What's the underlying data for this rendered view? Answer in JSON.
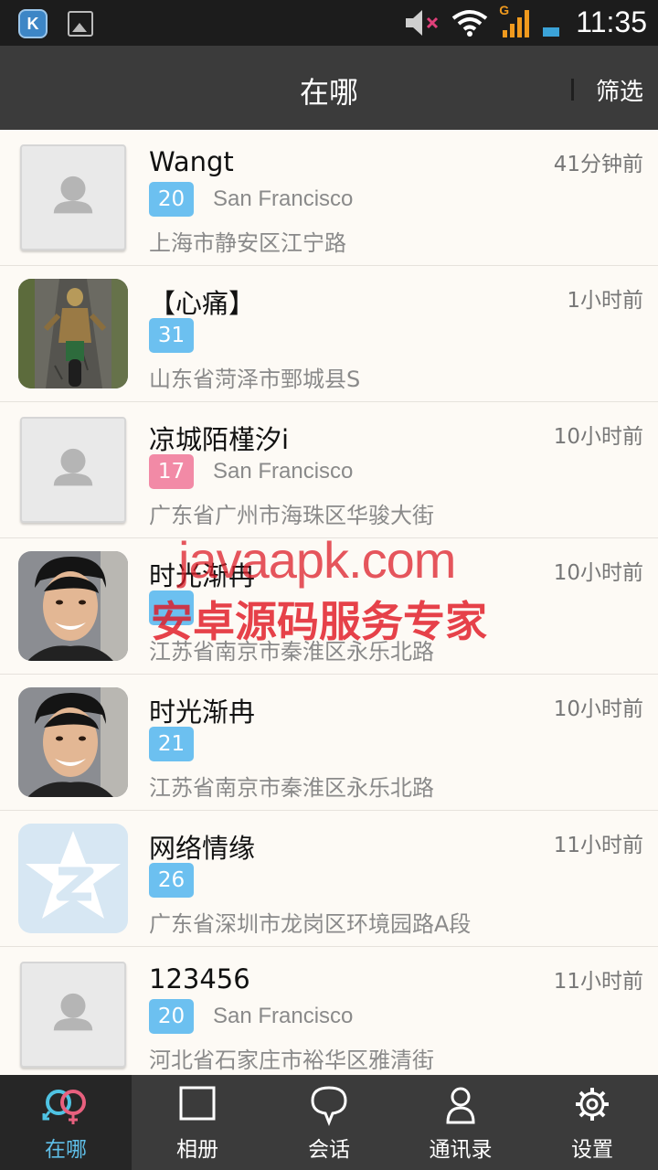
{
  "status_bar": {
    "time": "11:35",
    "app_icon_letter": "K",
    "network_label": "G",
    "icons": [
      "k-app-icon",
      "gallery-icon",
      "volume-muted-icon",
      "wifi-icon",
      "signal-icon",
      "battery-icon"
    ]
  },
  "header": {
    "title": "在哪",
    "filter_label": "筛选"
  },
  "colors": {
    "badge_blue": "#6cc0f0",
    "badge_pink": "#f28aa6",
    "accent": "#5fbfe8",
    "header_bg": "#3b3b3b"
  },
  "list": [
    {
      "name": "Wangt",
      "time": "41分钟前",
      "age": "20",
      "badge_color": "blue",
      "city": "San Francisco",
      "address": "上海市静安区江宁路",
      "avatar": "default-avatar"
    },
    {
      "name": "【心痛】",
      "time": "1小时前",
      "age": "31",
      "badge_color": "blue",
      "city": "",
      "address": "山东省菏泽市鄄城县S",
      "avatar": "motorcycle-photo"
    },
    {
      "name": "凉城陌槿汐i",
      "time": "10小时前",
      "age": "17",
      "badge_color": "pink",
      "city": "San Francisco",
      "address": "广东省广州市海珠区华骏大街",
      "avatar": "default-avatar"
    },
    {
      "name": "时光渐冉",
      "time": "10小时前",
      "age": "",
      "badge_color": "blue",
      "city": "",
      "address": "江苏省南京市秦淮区永乐北路",
      "avatar": "portrait-photo"
    },
    {
      "name": "时光渐冉",
      "time": "10小时前",
      "age": "21",
      "badge_color": "blue",
      "city": "",
      "address": "江苏省南京市秦淮区永乐北路",
      "avatar": "portrait-photo"
    },
    {
      "name": "网络情缘",
      "time": "11小时前",
      "age": "26",
      "badge_color": "blue",
      "city": "",
      "address": "广东省深圳市龙岗区环境园路A段",
      "avatar": "qzone-star-logo"
    },
    {
      "name": "123456",
      "time": "11小时前",
      "age": "20",
      "badge_color": "blue",
      "city": "San Francisco",
      "address": "河北省石家庄市裕华区雅清街",
      "avatar": "default-avatar"
    }
  ],
  "watermark": {
    "line1": "javaapk.com",
    "line2": "安卓源码服务专家"
  },
  "tabs": [
    {
      "label": "在哪",
      "icon": "gender-rings-icon",
      "active": true
    },
    {
      "label": "相册",
      "icon": "album-square-icon",
      "active": false
    },
    {
      "label": "会话",
      "icon": "chat-bubble-icon",
      "active": false
    },
    {
      "label": "通讯录",
      "icon": "contact-person-icon",
      "active": false
    },
    {
      "label": "设置",
      "icon": "gear-icon",
      "active": false
    }
  ]
}
